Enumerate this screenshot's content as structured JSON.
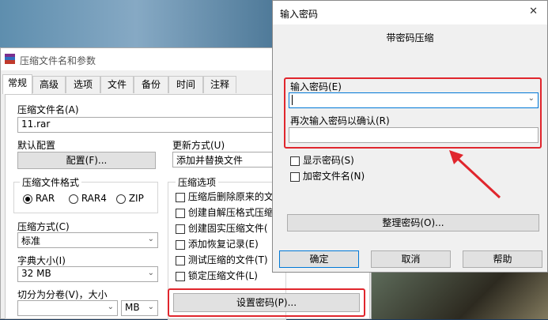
{
  "back_dialog": {
    "title": "压缩文件名和参数",
    "tabs": [
      "常规",
      "高级",
      "选项",
      "文件",
      "备份",
      "时间",
      "注释"
    ],
    "archive_name_label": "压缩文件名(A)",
    "archive_name_value": "11.rar",
    "default_config_label": "默认配置",
    "config_button": "配置(F)...",
    "update_mode_label": "更新方式(U)",
    "update_mode_value": "添加并替换文件",
    "format_group": "压缩文件格式",
    "formats": [
      "RAR",
      "RAR4",
      "ZIP"
    ],
    "options_group": "压缩选项",
    "options": [
      "压缩后删除原来的文",
      "创建自解压格式压缩",
      "创建固实压缩文件(",
      "添加恢复记录(E)",
      "测试压缩的文件(T)",
      "锁定压缩文件(L)"
    ],
    "method_label": "压缩方式(C)",
    "method_value": "标准",
    "dict_label": "字典大小(I)",
    "dict_value": "32 MB",
    "split_label": "切分为分卷(V)，大小",
    "split_value": "",
    "split_unit": "MB",
    "set_password_button": "设置密码(P)..."
  },
  "front_dialog": {
    "title": "输入密码",
    "close_symbol": "✕",
    "heading": "带密码压缩",
    "password_label": "输入密码(E)",
    "password_value": "",
    "confirm_label": "再次输入密码以确认(R)",
    "confirm_value": "",
    "show_password": "显示密码(S)",
    "encrypt_names": "加密文件名(N)",
    "organize_button": "整理密码(O)...",
    "ok_button": "确定",
    "cancel_button": "取消",
    "help_button": "帮助"
  },
  "colors": {
    "highlight": "#e0262d",
    "focus": "#0078d7"
  }
}
